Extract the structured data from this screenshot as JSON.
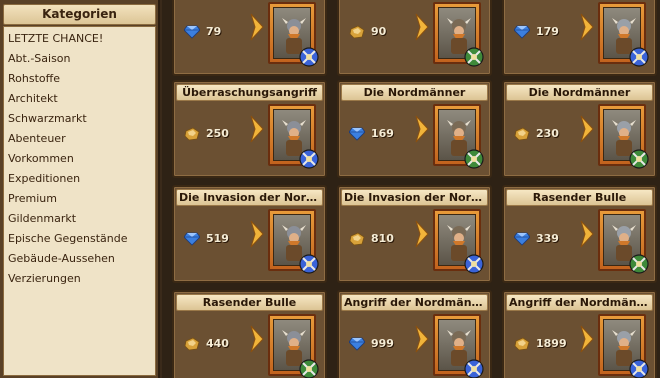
{
  "sidebar": {
    "title": "Kategorien",
    "items": [
      "LETZTE CHANCE!",
      "Abt.-Saison",
      "Rohstoffe",
      "Architekt",
      "Schwarzmarkt",
      "Abenteuer",
      "Vorkommen",
      "Expeditionen",
      "Premium",
      "Gildenmarkt",
      "Epische Gegenstände",
      "Gebäude-Aussehen",
      "Verzierungen"
    ]
  },
  "cards": [
    {
      "title": "",
      "price": "79",
      "currency": "gem",
      "badge": "blue"
    },
    {
      "title": "",
      "price": "90",
      "currency": "gold",
      "badge": "green"
    },
    {
      "title": "",
      "price": "179",
      "currency": "gem",
      "badge": "blue"
    },
    {
      "title": "Überraschungsangriff",
      "price": "250",
      "currency": "gold",
      "badge": "blue"
    },
    {
      "title": "Die Nordmänner",
      "price": "169",
      "currency": "gem",
      "badge": "green"
    },
    {
      "title": "Die Nordmänner",
      "price": "230",
      "currency": "gold",
      "badge": "green"
    },
    {
      "title": "Die Invasion der Nordm...",
      "price": "519",
      "currency": "gem",
      "badge": "blue"
    },
    {
      "title": "Die Invasion der Nordm...",
      "price": "810",
      "currency": "gold",
      "badge": "blue"
    },
    {
      "title": "Rasender Bulle",
      "price": "339",
      "currency": "gem",
      "badge": "green"
    },
    {
      "title": "Rasender Bulle",
      "price": "440",
      "currency": "gold",
      "badge": "green"
    },
    {
      "title": "Angriff der Nordmänner",
      "price": "999",
      "currency": "gem",
      "badge": "blue"
    },
    {
      "title": "Angriff der Nordmänner",
      "price": "1899",
      "currency": "gold",
      "badge": "blue"
    }
  ],
  "colors": {
    "gem": "#3b7fe0",
    "gold": "#d8a23a",
    "badge_blue": "#3a63d8",
    "badge_green": "#3e8a3a"
  },
  "icons": {
    "gem": "blue-gem-icon",
    "gold": "gold-coin-icon",
    "arrow": "arrow-right-icon",
    "badge": "unit-badge-icon"
  }
}
